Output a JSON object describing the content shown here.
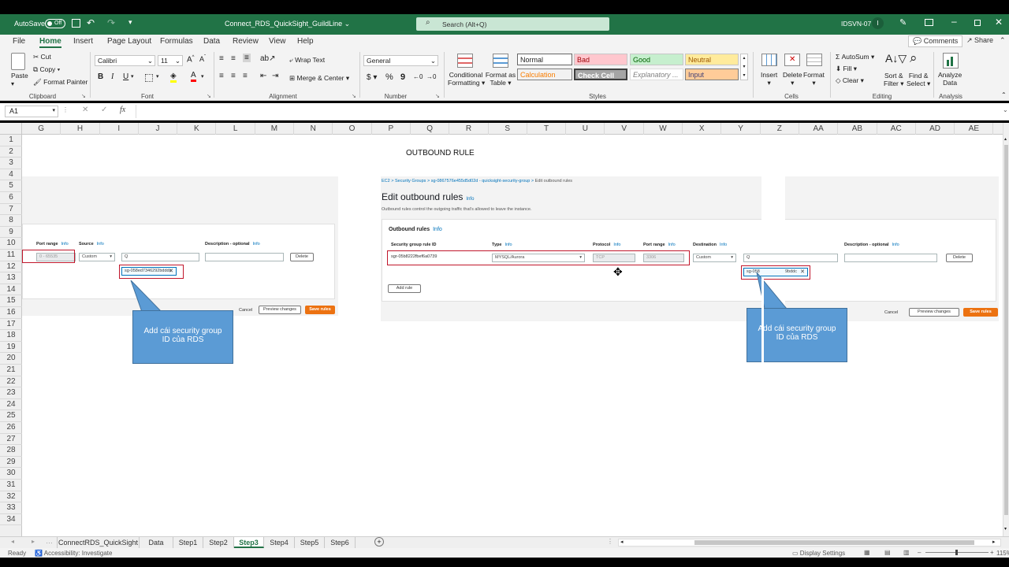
{
  "titlebar": {
    "autosave_label": "AutoSave",
    "autosave_state": "Off",
    "filename": "Connect_RDS_QuickSight_GuildLine",
    "search_placeholder": "Search (Alt+Q)",
    "user": "IDSVN-07",
    "user_initial": "I"
  },
  "ribbon_tabs": [
    "File",
    "Home",
    "Insert",
    "Page Layout",
    "Formulas",
    "Data",
    "Review",
    "View",
    "Help"
  ],
  "ribbon_right": {
    "comments": "Comments",
    "share": "Share"
  },
  "clipboard": {
    "paste": "Paste",
    "cut": "Cut",
    "copy": "Copy",
    "format_painter": "Format Painter",
    "group": "Clipboard"
  },
  "font": {
    "name": "Calibri",
    "size": "11",
    "bold": "B",
    "italic": "I",
    "underline": "U",
    "group": "Font"
  },
  "alignment": {
    "wrap_text": "Wrap Text",
    "merge_center": "Merge & Center",
    "group": "Alignment"
  },
  "number": {
    "format": "General",
    "currency": "$",
    "percent": "%",
    "comma": "9",
    "group": "Number"
  },
  "styles": {
    "conditional": [
      "Conditional",
      "Formatting"
    ],
    "format_table": [
      "Format as",
      "Table"
    ],
    "normal": "Normal",
    "bad": "Bad",
    "good": "Good",
    "neutral": "Neutral",
    "calculation": "Calculation",
    "check_cell": "Check Cell",
    "explanatory": "Explanatory ...",
    "input": "Input",
    "group": "Styles",
    "colors": {
      "bad_bg": "#ffc7ce",
      "good_bg": "#c6efce",
      "neutral_bg": "#ffeb9c",
      "calc_bg": "#f2f2f2",
      "check_bg": "#a5a5a5",
      "input_bg": "#ffcc99"
    }
  },
  "cells": {
    "insert": "Insert",
    "delete": "Delete",
    "format": "Format",
    "group": "Cells"
  },
  "editing": {
    "autosum": "AutoSum",
    "fill": "Fill",
    "clear": "Clear",
    "sort_filter": [
      "Sort &",
      "Filter"
    ],
    "find_select": [
      "Find &",
      "Select"
    ],
    "group": "Editing"
  },
  "analysis": {
    "analyze": [
      "Analyze",
      "Data"
    ],
    "group": "Analysis"
  },
  "formula_bar": {
    "name_box": "A1",
    "fx": "fx",
    "value": ""
  },
  "columns": [
    "G",
    "H",
    "I",
    "J",
    "K",
    "L",
    "M",
    "N",
    "O",
    "P",
    "Q",
    "R",
    "S",
    "T",
    "U",
    "V",
    "W",
    "X",
    "Y",
    "Z",
    "AA",
    "AB",
    "AC",
    "AD",
    "AE"
  ],
  "rows": [
    "1",
    "2",
    "3",
    "4",
    "5",
    "6",
    "7",
    "8",
    "9",
    "10",
    "11",
    "12",
    "13",
    "14",
    "15",
    "16",
    "17",
    "18",
    "19",
    "20",
    "21",
    "22",
    "23",
    "24",
    "25",
    "26",
    "27",
    "28",
    "29",
    "30",
    "31",
    "32",
    "33",
    "34"
  ],
  "sheet_title": "OUTBOUND RULE",
  "left_shot": {
    "port_range_label": "Port range",
    "source_label": "Source",
    "desc_label": "Description - optional",
    "info": "Info",
    "port_value": "0 - 65535",
    "source_value": "Custom",
    "search_icon_text": "Q",
    "delete": "Delete",
    "sg_chip": "sg-058ed7346292bdddc",
    "cancel": "Cancel",
    "preview": "Preview changes",
    "save": "Save rules"
  },
  "right_shot": {
    "breadcrumb": [
      "EC2",
      "Security Groups",
      "sg-0867576e455d5d02d - quicksight-security-group",
      "Edit outbound rules"
    ],
    "title": "Edit outbound rules",
    "info": "Info",
    "subtitle": "Outbound rules control the outgoing traffic that's allowed to leave the instance.",
    "panel_title": "Outbound rules",
    "headers": [
      "Security group rule ID",
      "Type",
      "Protocol",
      "Port range",
      "Destination",
      "Description - optional"
    ],
    "rule_id": "sgr-05b8222fbef6a0739",
    "type_value": "MYSQL/Aurora",
    "protocol_value": "TCP",
    "port_value": "3306",
    "dest_value": "Custom",
    "search_icon_text": "Q",
    "delete": "Delete",
    "sg_chip_left": "sg-058",
    "sg_chip_right": "9bddc",
    "add_rule": "Add rule",
    "cancel": "Cancel",
    "preview": "Preview changes",
    "save": "Save rules"
  },
  "callouts": {
    "left": "Add cái security group ID của RDS",
    "right": "Add cái security group ID của RDS"
  },
  "sheet_tabs": [
    "ConnectRDS_QuickSight",
    "Data",
    "Step1",
    "Step2",
    "Step3",
    "Step4",
    "Step5",
    "Step6"
  ],
  "active_sheet": "Step3",
  "status": {
    "ready": "Ready",
    "accessibility": "Accessibility: Investigate",
    "display": "Display Settings",
    "zoom": "115%"
  }
}
